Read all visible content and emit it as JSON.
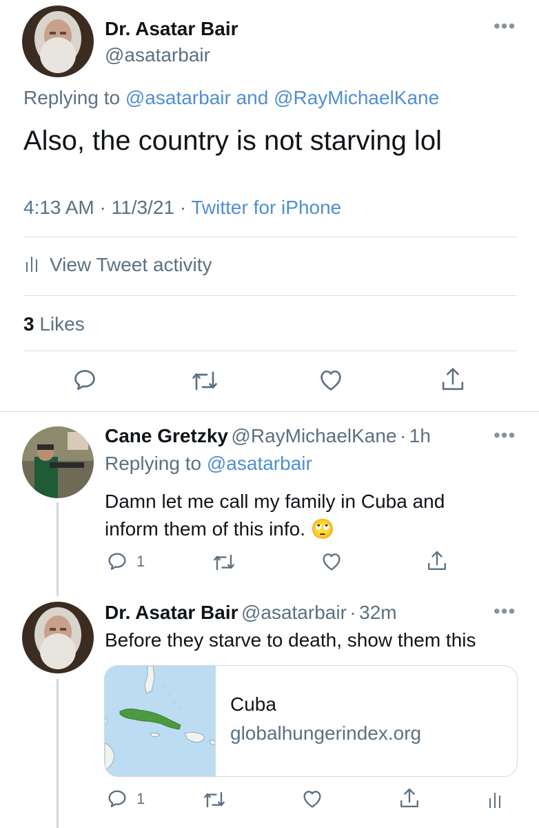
{
  "main_tweet": {
    "author_name": "Dr. Asatar Bair",
    "author_handle": "@asatarbair",
    "replying_prefix": "Replying to",
    "reply_to_1": "@asatarbair",
    "reply_and": "and",
    "reply_to_2": "@RayMichaelKane",
    "text": "Also, the country is not starving lol",
    "time": "4:13 AM",
    "sep1": "·",
    "date": "11/3/21",
    "sep2": "·",
    "source": "Twitter for iPhone",
    "view_activity": "View Tweet activity",
    "likes_count": "3",
    "likes_label": "Likes"
  },
  "reply1": {
    "author_name": "Cane Gretzky",
    "author_handle": "@RayMichaelKane",
    "sep": "·",
    "time_ago": "1h",
    "replying_prefix": "Replying to",
    "reply_to": "@asatarbair",
    "text_line1": "Damn let me call my family in Cuba and",
    "text_line2": "inform them of this info. 🙄",
    "reply_count": "1"
  },
  "reply2": {
    "author_name": "Dr. Asatar Bair",
    "author_handle": "@asatarbair",
    "sep": "·",
    "time_ago": "32m",
    "text": "Before they starve to death, show them this",
    "card_title": "Cuba",
    "card_domain": "globalhungerindex.org",
    "reply_count": "1"
  },
  "colors": {
    "link_blue": "#4f8fd0",
    "secondary_grey": "#5b7083",
    "map_water": "#bcdcf2",
    "map_cuba": "#4c9a3f"
  },
  "icons": [
    "more-icon",
    "bar-chart-icon",
    "reply-icon",
    "retweet-icon",
    "like-icon",
    "share-icon",
    "analytics-icon"
  ]
}
